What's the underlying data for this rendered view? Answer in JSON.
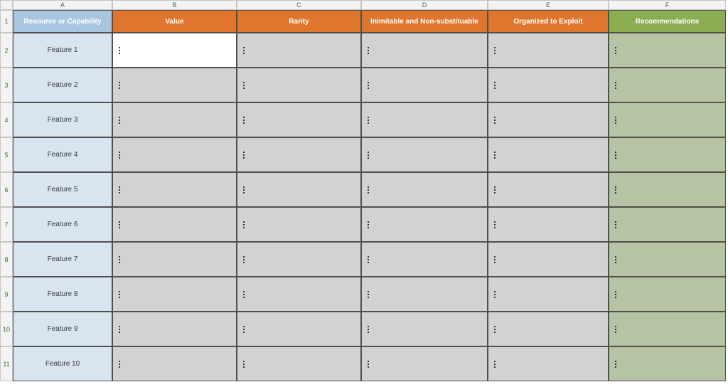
{
  "columns": [
    "A",
    "B",
    "C",
    "D",
    "E",
    "F"
  ],
  "rows": [
    "1",
    "2",
    "3",
    "4",
    "5",
    "6",
    "7",
    "8",
    "9",
    "10",
    "11"
  ],
  "headers": {
    "a": "Resource or Capability",
    "b": "Value",
    "c": "Rarity",
    "d": "Inimitable and Non-substituable",
    "e": "Organized to Exploit",
    "f": "Recommendations"
  },
  "features": [
    "Feature 1",
    "Feature 2",
    "Feature 3",
    "Feature 4",
    "Feature 5",
    "Feature 6",
    "Feature 7",
    "Feature 8",
    "Feature 9",
    "Feature 10"
  ],
  "selected_cell": {
    "row": 2,
    "col": "B"
  }
}
